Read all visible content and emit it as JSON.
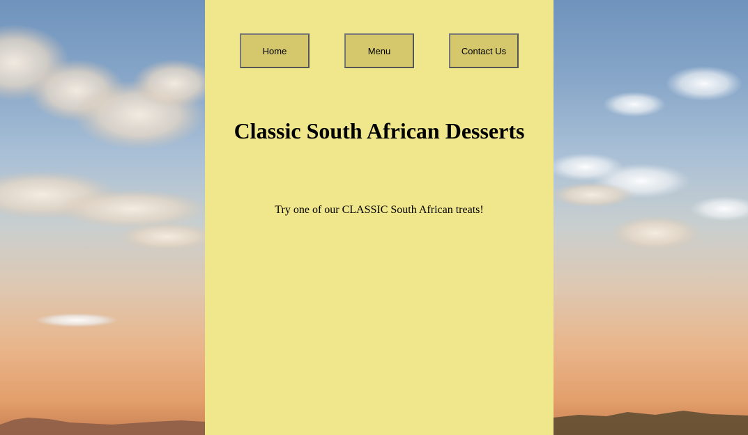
{
  "nav": {
    "home_label": "Home",
    "menu_label": "Menu",
    "contact_label": "Contact Us"
  },
  "main": {
    "title": "Classic South African Desserts",
    "tagline": "Try one of our CLASSIC South African treats!"
  },
  "colors": {
    "panel_background": "#f0e68c",
    "button_background": "#d4c76c",
    "button_border": "#555555",
    "text": "#000000"
  }
}
